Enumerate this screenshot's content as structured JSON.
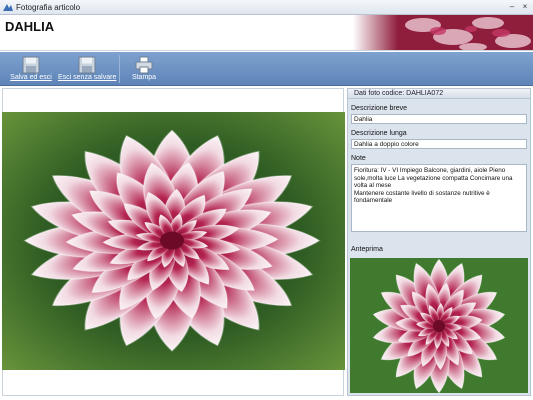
{
  "window": {
    "title": "Fotografia articolo",
    "minimize": "–",
    "close": "×"
  },
  "header": {
    "page_title": "DAHLIA"
  },
  "toolbar": {
    "save_exit": "Salva ed esci",
    "exit_no_save": "Esci senza salvare",
    "print": "Stampa"
  },
  "details": {
    "header": "Dati foto codice: DAHLIA072",
    "short_desc_label": "Descrizione breve",
    "short_desc_value": "Dahlia",
    "long_desc_label": "Descrizione lunga",
    "long_desc_value": "Dahlia a doppio colore",
    "notes_label": "Note",
    "notes_value": "Fioritura: IV - VI Impiego Balcone, giardini, aiole Pieno sole,molta luce La vegetazione compatta Concimare una volta al mese\nMantenere costante livello di sostanze nutritive è fondamentale",
    "preview_label": "Anteprima"
  },
  "colors": {
    "accent": "#5e84b8",
    "petal": "#b3234f",
    "leaf": "#3f7a2e"
  },
  "icons": [
    "app-icon",
    "save-disk-icon",
    "exit-disk-icon",
    "printer-icon"
  ]
}
